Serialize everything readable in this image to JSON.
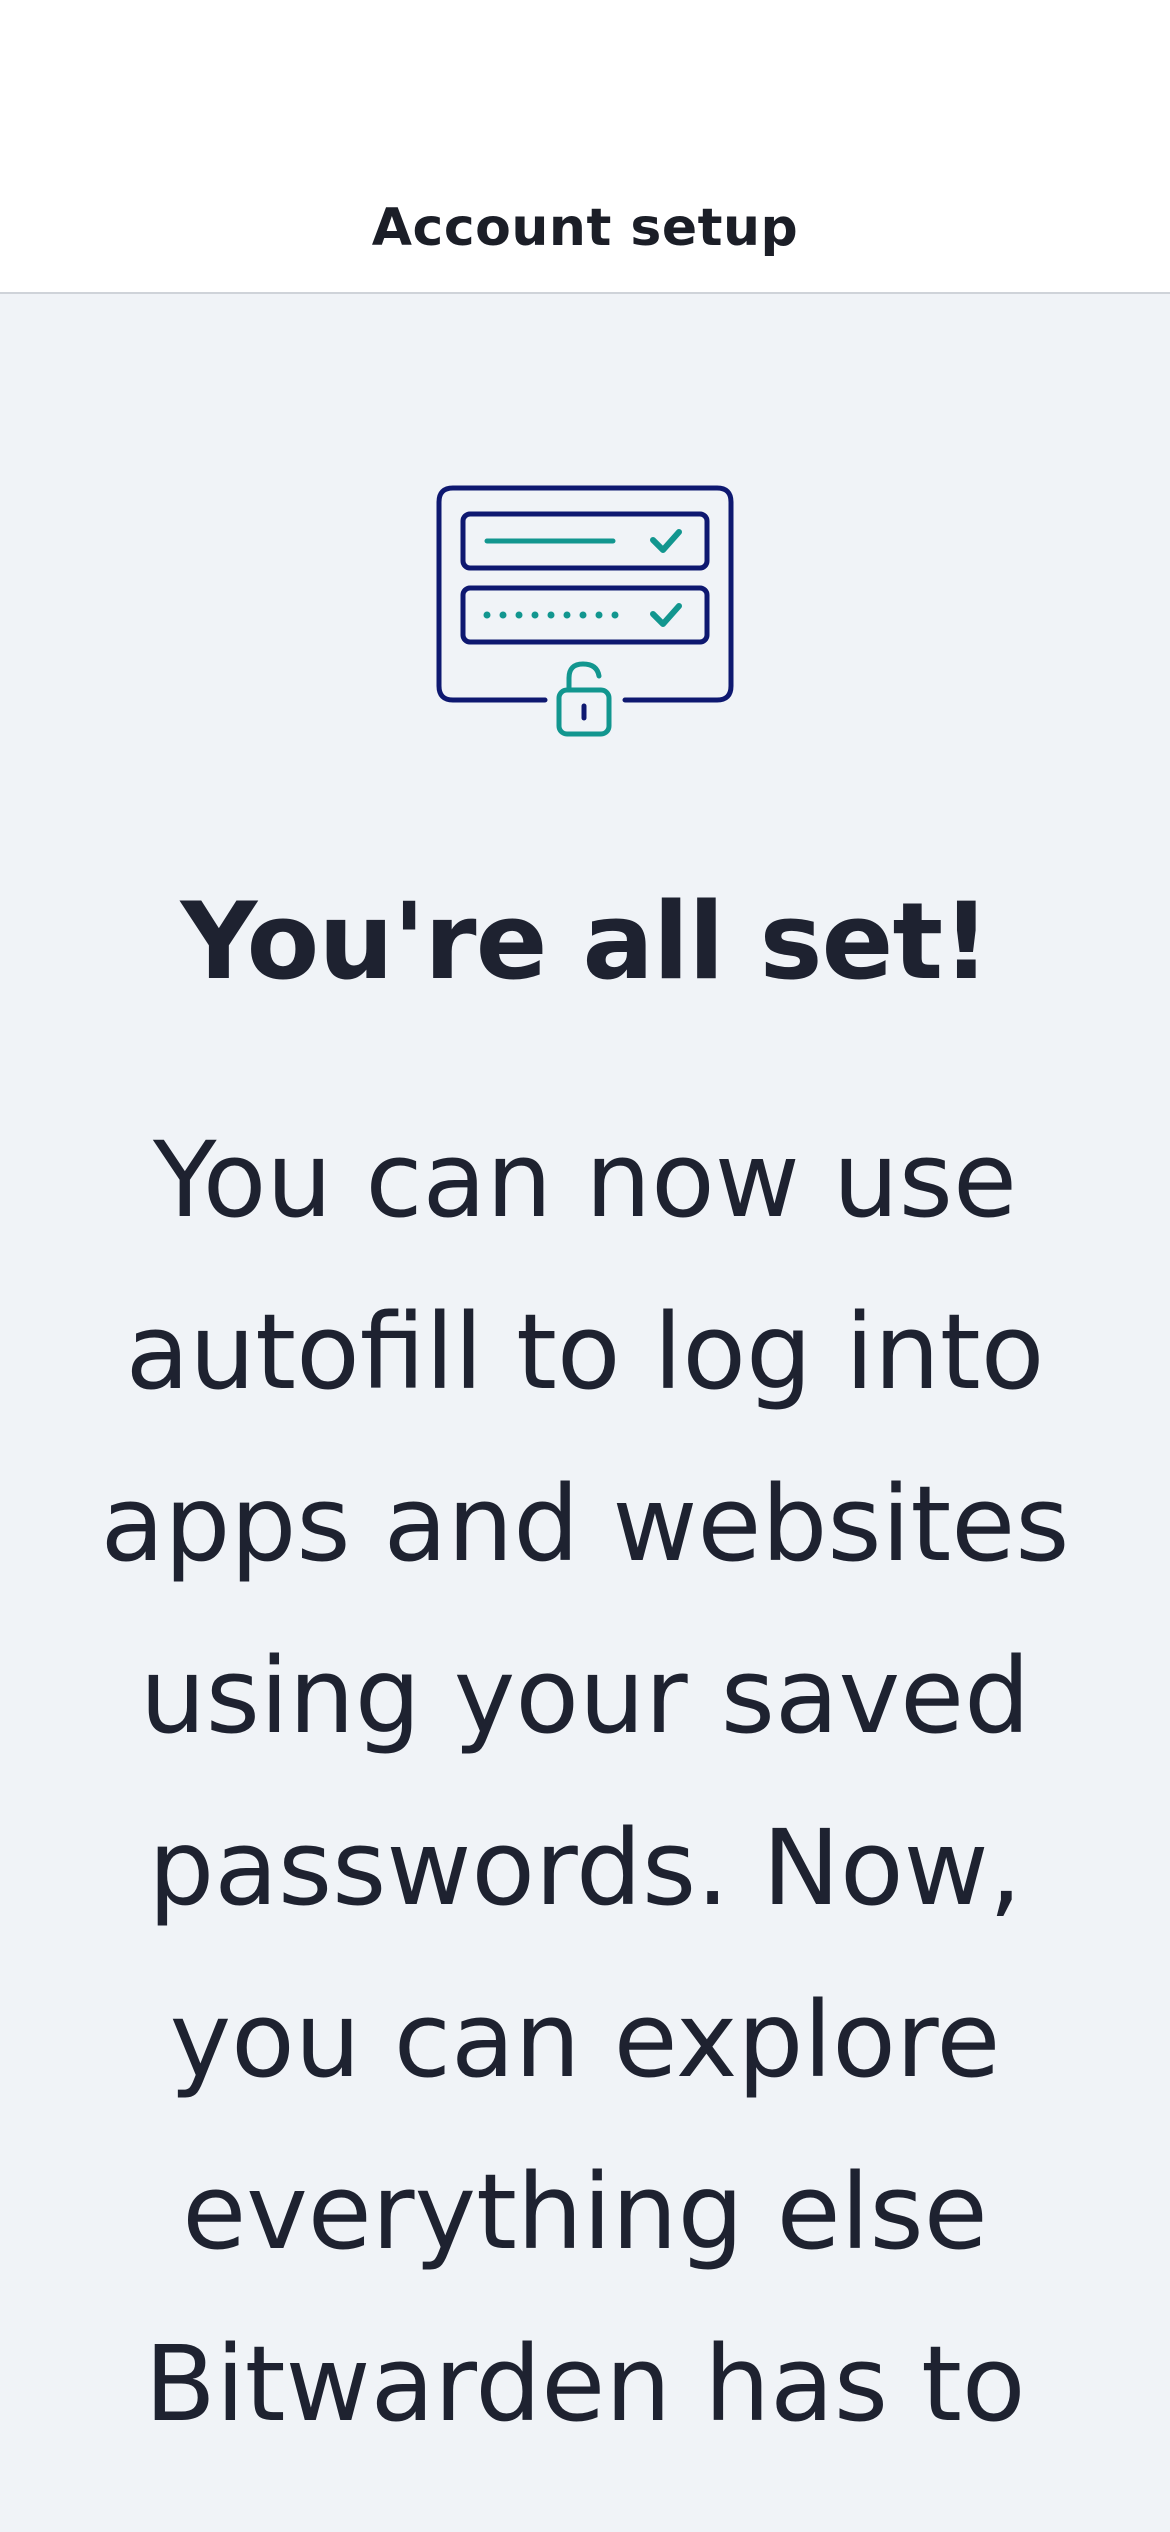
{
  "header": {
    "title": "Account setup"
  },
  "illustration": {
    "icon": "password-autofill-unlocked-icon",
    "colors": {
      "outline": "#0e1870",
      "accent": "#12968f"
    }
  },
  "main": {
    "headline": "You're all set!",
    "body": "You can now use autofill to log into apps and websites using your saved passwords. Now, you can explore everything else Bitwarden has to"
  }
}
